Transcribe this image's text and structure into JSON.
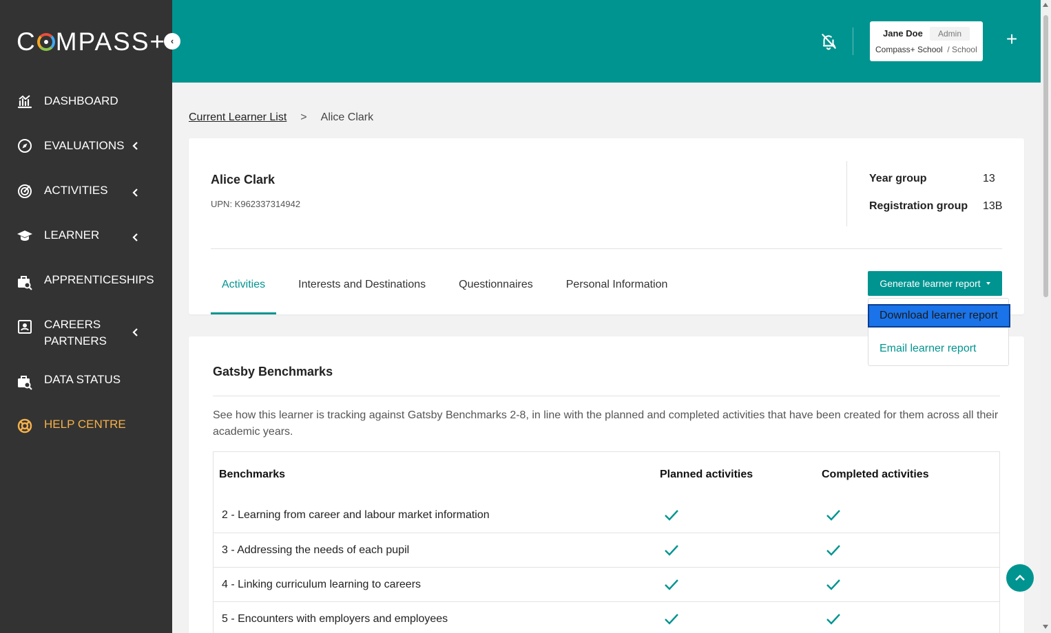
{
  "brand": {
    "logo_left": "C",
    "logo_right": "MPASS+",
    "accent": "#009490",
    "sidebar_bg": "#333333",
    "help_color": "#f5b14a"
  },
  "sidebar": {
    "collapse_glyph": "‹",
    "items": [
      {
        "label": "DASHBOARD",
        "icon": "chart-icon",
        "has_submenu": false
      },
      {
        "label": "EVALUATIONS",
        "icon": "compass-icon",
        "has_submenu": true
      },
      {
        "label": "ACTIVITIES",
        "icon": "target-icon",
        "has_submenu": true
      },
      {
        "label": "LEARNER",
        "icon": "graduation-cap-icon",
        "has_submenu": true
      },
      {
        "label": "APPRENTICESHIPS",
        "icon": "briefcase-search-icon",
        "has_submenu": false
      },
      {
        "label_line1": "CAREERS",
        "label_line2": "PARTNERS",
        "icon": "id-card-icon",
        "has_submenu": true
      },
      {
        "label": "DATA STATUS",
        "icon": "briefcase-search-icon",
        "has_submenu": false
      },
      {
        "label": "HELP CENTRE",
        "icon": "lifebuoy-icon",
        "has_submenu": false
      }
    ]
  },
  "header": {
    "notifications_icon": "bell-off-icon",
    "user": {
      "name": "Jane Doe",
      "role": "Admin",
      "school": "Compass+ School",
      "school_type": "/ School"
    },
    "add_glyph": "+"
  },
  "breadcrumb": {
    "parent": "Current Learner List",
    "separator": ">",
    "current": "Alice Clark"
  },
  "learner": {
    "name": "Alice Clark",
    "upn": "UPN: K962337314942",
    "year_group_label": "Year group",
    "year_group_value": "13",
    "registration_group_label": "Registration group",
    "registration_group_value": "13B"
  },
  "tabs": [
    {
      "label": "Activities",
      "active": true
    },
    {
      "label": "Interests and Destinations",
      "active": false
    },
    {
      "label": "Questionnaires",
      "active": false
    },
    {
      "label": "Personal Information",
      "active": false
    }
  ],
  "report": {
    "button_label": "Generate learner report",
    "menu": {
      "download": "Download learner report",
      "email": "Email learner report"
    }
  },
  "benchmarks": {
    "title": "Gatsby Benchmarks",
    "description": "See how this learner is tracking against Gatsby Benchmarks 2-8, in line with the planned and completed activities that have been created for them across all their academic years.",
    "columns": [
      "Benchmarks",
      "Planned activities",
      "Completed activities"
    ],
    "rows": [
      {
        "name": "2 - Learning from career and labour market information",
        "planned": true,
        "completed": true
      },
      {
        "name": "3 - Addressing the needs of each pupil",
        "planned": true,
        "completed": true
      },
      {
        "name": "4 - Linking curriculum learning to careers",
        "planned": true,
        "completed": true
      },
      {
        "name": "5 - Encounters with employers and employees",
        "planned": true,
        "completed": true
      }
    ]
  }
}
